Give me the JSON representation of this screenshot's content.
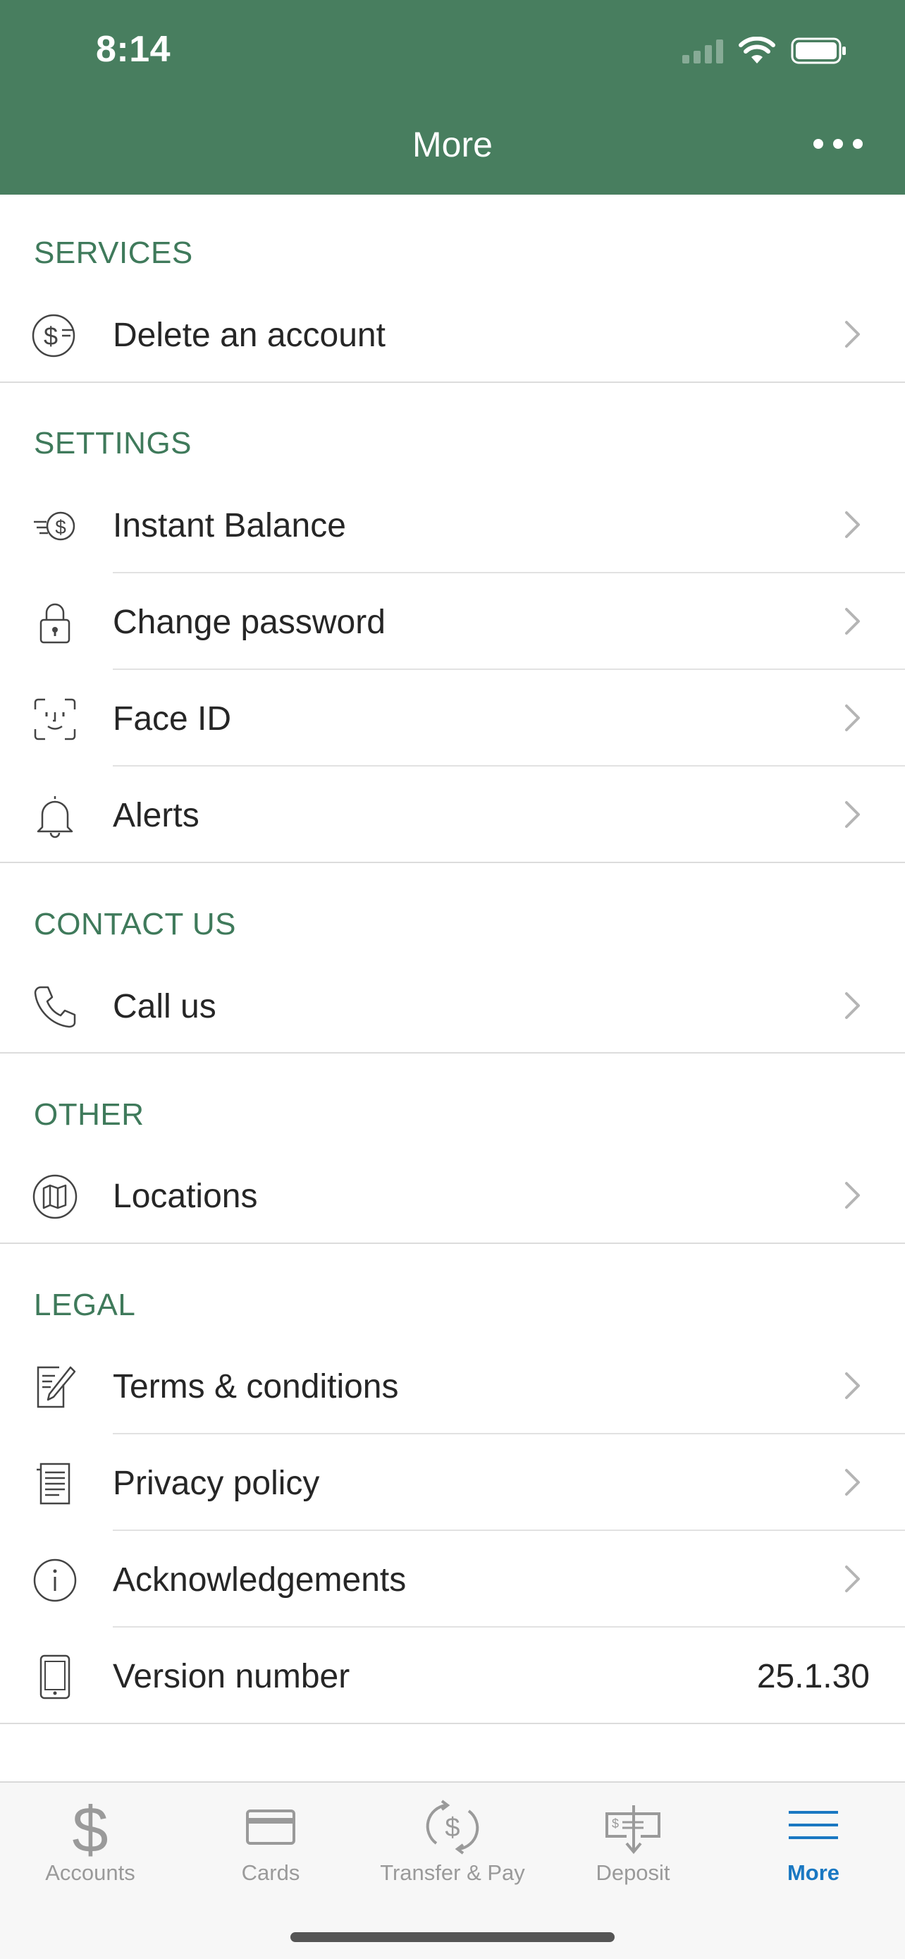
{
  "status_bar": {
    "time": "8:14"
  },
  "header": {
    "title": "More"
  },
  "colors": {
    "header_bg": "#487e5f",
    "section_text": "#3f7a5b",
    "tab_active": "#1a78c2",
    "tab_inactive": "#9a9a9a"
  },
  "sections": {
    "services": {
      "title": "SERVICES",
      "items": [
        {
          "label": "Delete an account",
          "icon": "dollar-circle-icon"
        }
      ]
    },
    "settings": {
      "title": "SETTINGS",
      "items": [
        {
          "label": "Instant Balance",
          "icon": "instant-balance-icon"
        },
        {
          "label": "Change password",
          "icon": "lock-icon"
        },
        {
          "label": "Face ID",
          "icon": "face-id-icon"
        },
        {
          "label": "Alerts",
          "icon": "bell-icon"
        }
      ]
    },
    "contact": {
      "title": "CONTACT US",
      "items": [
        {
          "label": "Call us",
          "icon": "phone-icon"
        }
      ]
    },
    "other": {
      "title": "OTHER",
      "items": [
        {
          "label": "Locations",
          "icon": "map-icon"
        }
      ]
    },
    "legal": {
      "title": "LEGAL",
      "items": [
        {
          "label": "Terms & conditions",
          "icon": "document-pen-icon"
        },
        {
          "label": "Privacy policy",
          "icon": "document-lines-icon"
        },
        {
          "label": "Acknowledgements",
          "icon": "info-icon"
        },
        {
          "label": "Version number",
          "value": "25.1.30",
          "icon": "phone-device-icon"
        }
      ]
    }
  },
  "tabbar": {
    "tabs": [
      {
        "label": "Accounts",
        "icon": "dollar-icon"
      },
      {
        "label": "Cards",
        "icon": "card-icon"
      },
      {
        "label": "Transfer & Pay",
        "icon": "transfer-icon"
      },
      {
        "label": "Deposit",
        "icon": "deposit-check-icon"
      },
      {
        "label": "More",
        "icon": "menu-icon",
        "active": true
      }
    ]
  }
}
